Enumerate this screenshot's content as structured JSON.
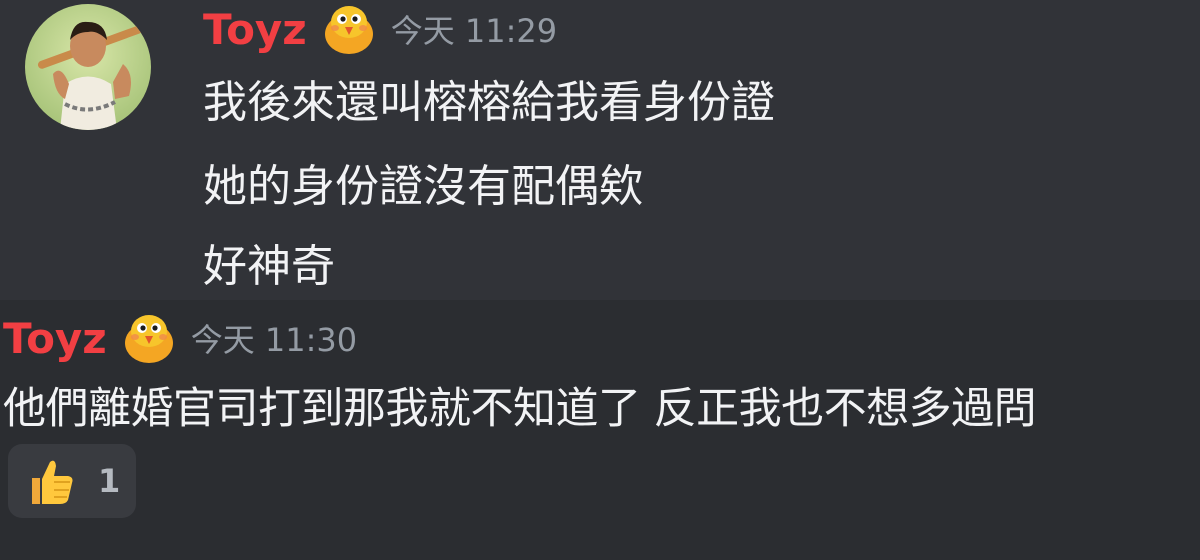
{
  "messages": [
    {
      "username": "Toyz",
      "timestamp": "今天 11:29",
      "lines": [
        "我後來還叫榕榕給我看身份證",
        "她的身份證沒有配偶欸",
        "好神奇"
      ]
    },
    {
      "username": "Toyz",
      "timestamp": "今天 11:30",
      "lines": [
        "他們離婚官司打到那我就不知道了 反正我也不想多過問"
      ],
      "reaction": {
        "emoji": "thumbs-up",
        "count": "1"
      }
    }
  ],
  "colors": {
    "background": "#313338",
    "hover_background": "#2b2d31",
    "username": "#f23f43",
    "timestamp": "#949ba4",
    "message_text": "#f2f3f5",
    "reaction_background": "#393b40"
  },
  "icons": {
    "avatar": "user-avatar",
    "badge": "bird-emoji-badge",
    "reaction": "thumbs-up-icon"
  }
}
